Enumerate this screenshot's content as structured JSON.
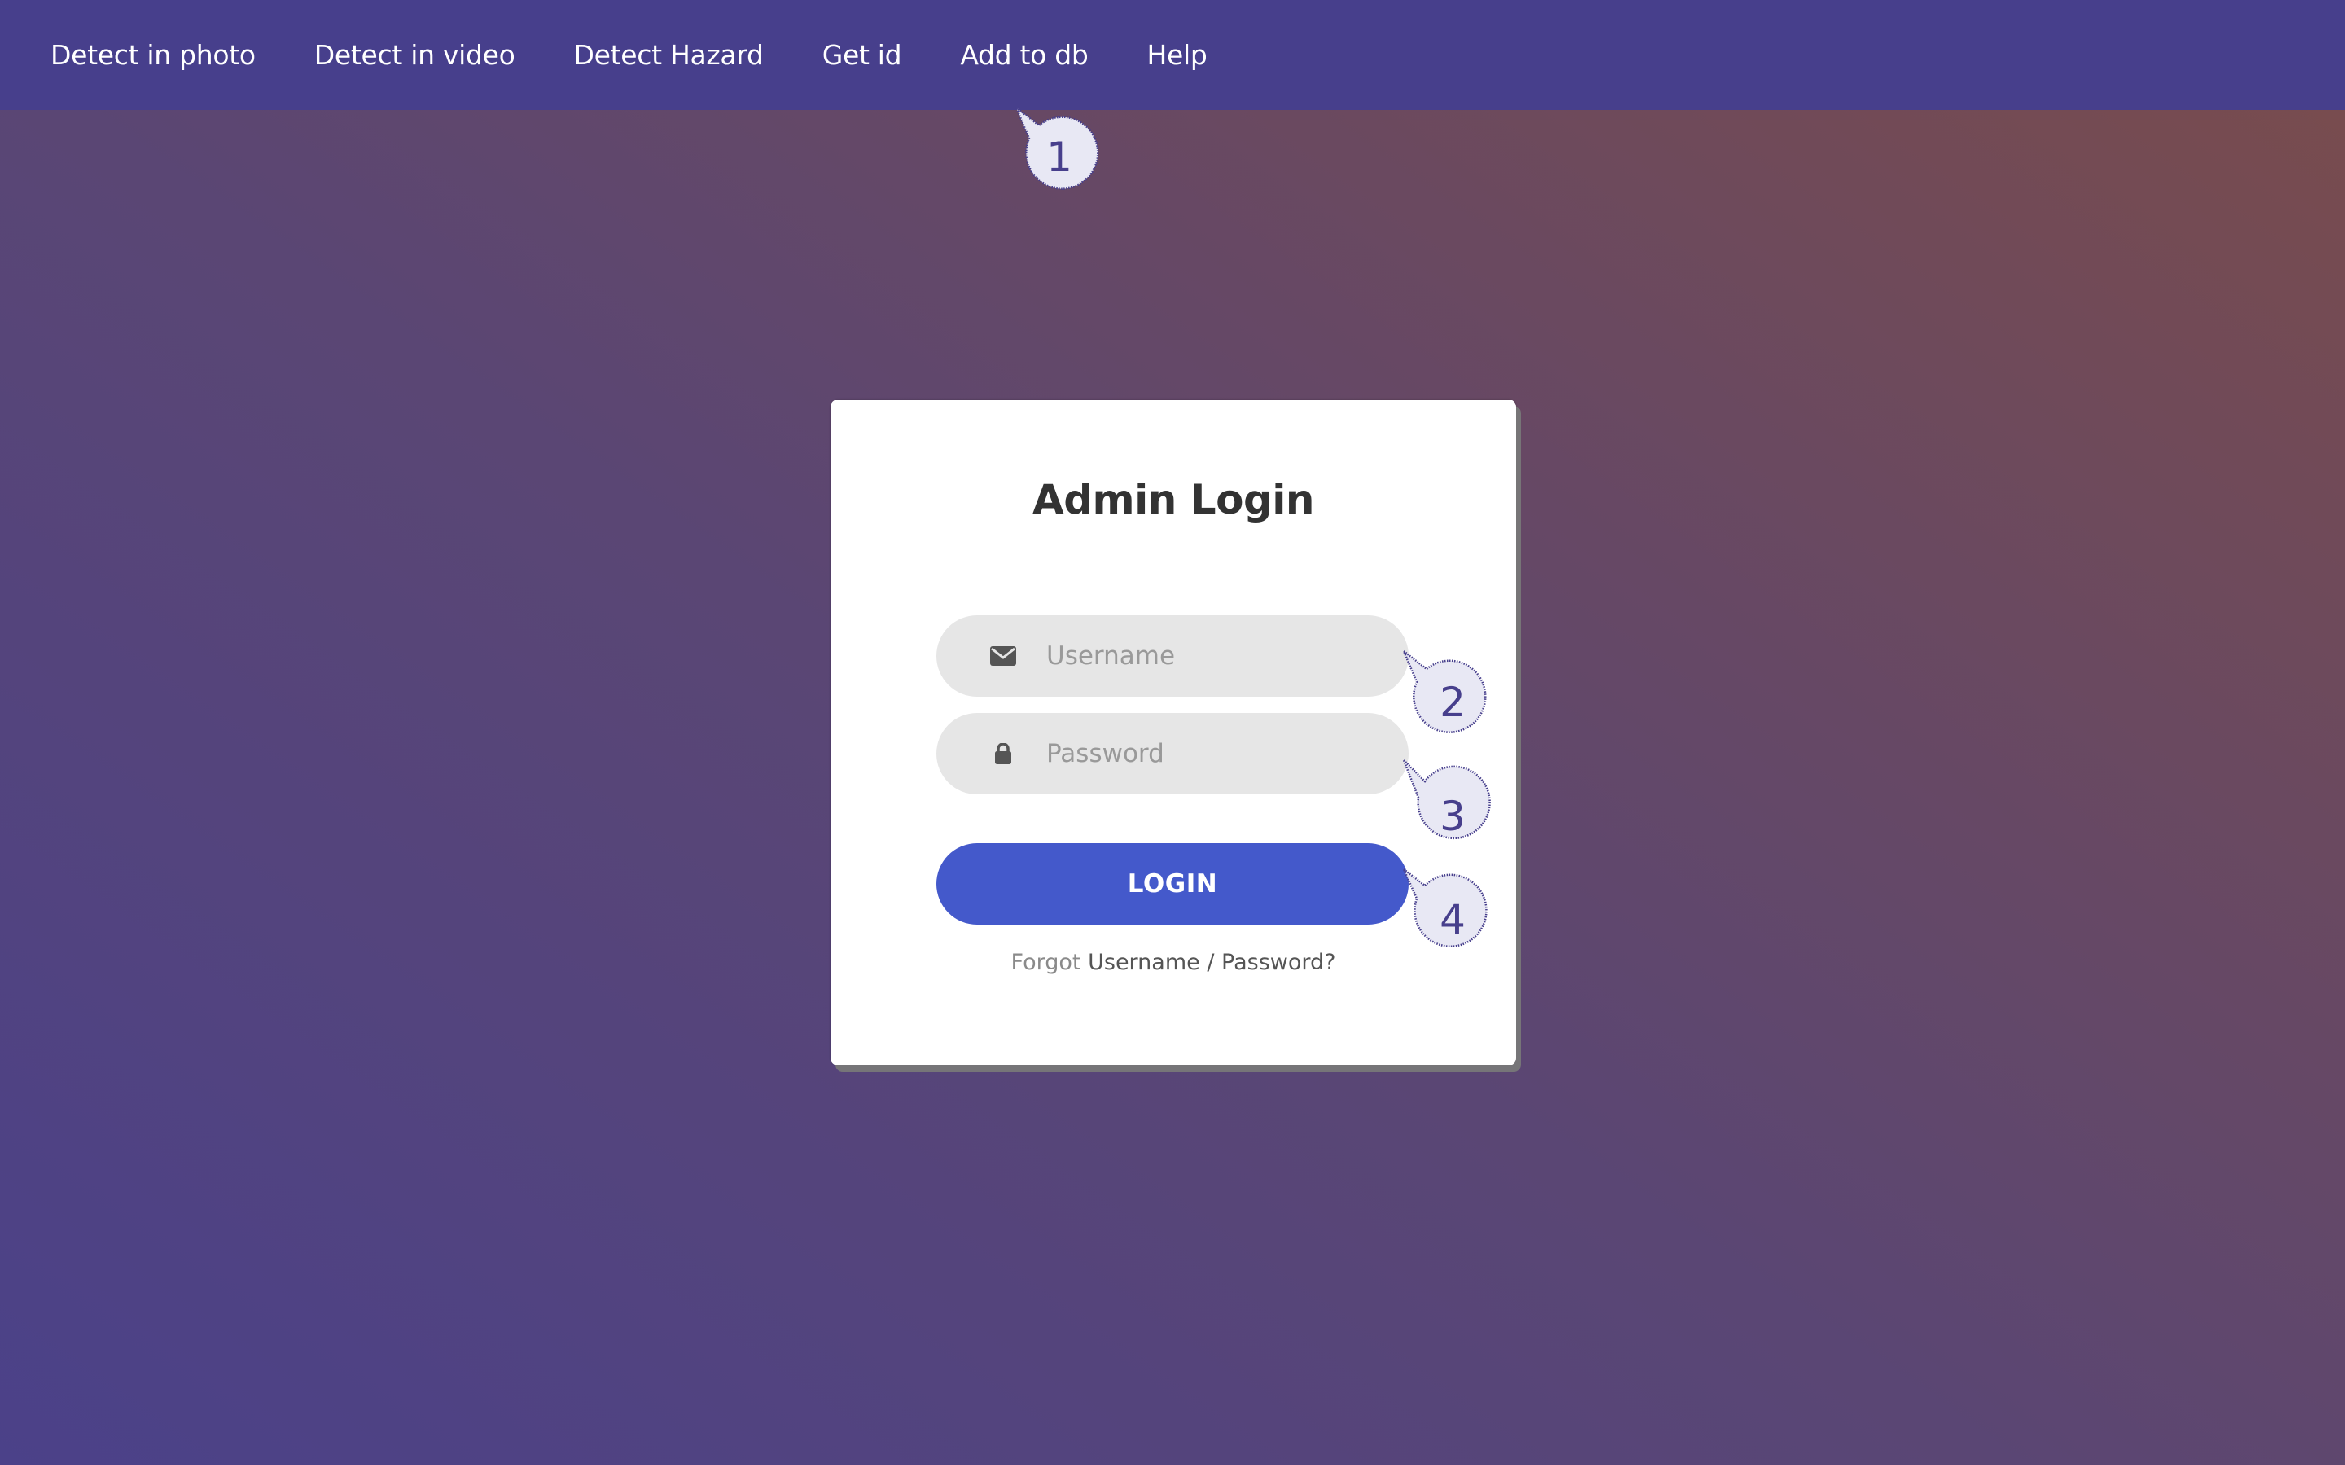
{
  "navbar": {
    "items": [
      {
        "label": "Detect in photo"
      },
      {
        "label": "Detect in video"
      },
      {
        "label": "Detect Hazard"
      },
      {
        "label": "Get id"
      },
      {
        "label": "Add to db"
      },
      {
        "label": "Help"
      }
    ]
  },
  "login": {
    "title": "Admin Login",
    "username": {
      "placeholder": "Username",
      "value": "",
      "icon": "envelope-icon"
    },
    "password": {
      "placeholder": "Password",
      "value": "",
      "icon": "lock-icon"
    },
    "button_label": "LOGIN",
    "forgot_prefix": "Forgot",
    "forgot_link": "Username / Password?"
  },
  "annotations": {
    "callouts": [
      {
        "number": "1"
      },
      {
        "number": "2"
      },
      {
        "number": "3"
      },
      {
        "number": "4"
      }
    ]
  },
  "colors": {
    "navbar": "#473f8c",
    "accent": "#4459cb",
    "callout_stroke": "#473f8c",
    "callout_fill": "#e8e8f4"
  }
}
